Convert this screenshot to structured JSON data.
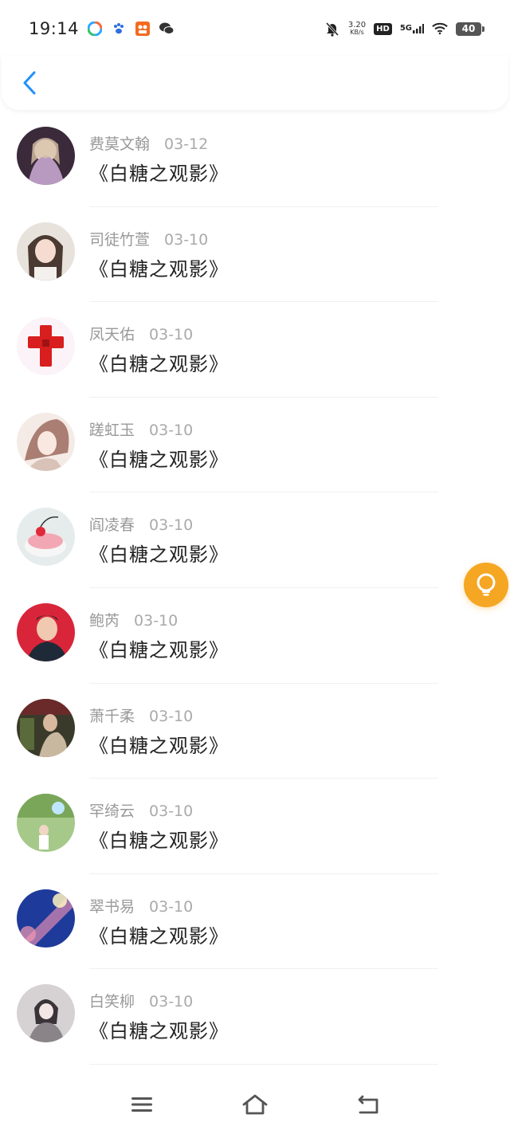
{
  "status_bar": {
    "time": "19:14",
    "net_speed_value": "3.20",
    "net_speed_unit": "KB/s",
    "hd": "HD",
    "network": "5G",
    "battery": "40"
  },
  "nav": {
    "back_icon": "chevron-left-icon",
    "accent": "#1e90ff"
  },
  "comments": [
    {
      "name": "费莫文翰",
      "date": "03-12",
      "title": "《白糖之观影》"
    },
    {
      "name": "司徒竹萱",
      "date": "03-10",
      "title": "《白糖之观影》"
    },
    {
      "name": "凤天佑",
      "date": "03-10",
      "title": "《白糖之观影》"
    },
    {
      "name": "蹉虹玉",
      "date": "03-10",
      "title": "《白糖之观影》"
    },
    {
      "name": "阎凌春",
      "date": "03-10",
      "title": "《白糖之观影》"
    },
    {
      "name": "鲍芮",
      "date": "03-10",
      "title": "《白糖之观影》"
    },
    {
      "name": "萧千柔",
      "date": "03-10",
      "title": "《白糖之观影》"
    },
    {
      "name": "罕绮云",
      "date": "03-10",
      "title": "《白糖之观影》"
    },
    {
      "name": "翠书易",
      "date": "03-10",
      "title": "《白糖之观影》"
    },
    {
      "name": "白笑柳",
      "date": "03-10",
      "title": "《白糖之观影》"
    }
  ],
  "floating": {
    "icon": "lightbulb-icon",
    "color": "#f5a623"
  },
  "bottom_nav": {
    "menu_icon": "menu-icon",
    "home_icon": "home-icon",
    "back_icon": "return-icon"
  }
}
